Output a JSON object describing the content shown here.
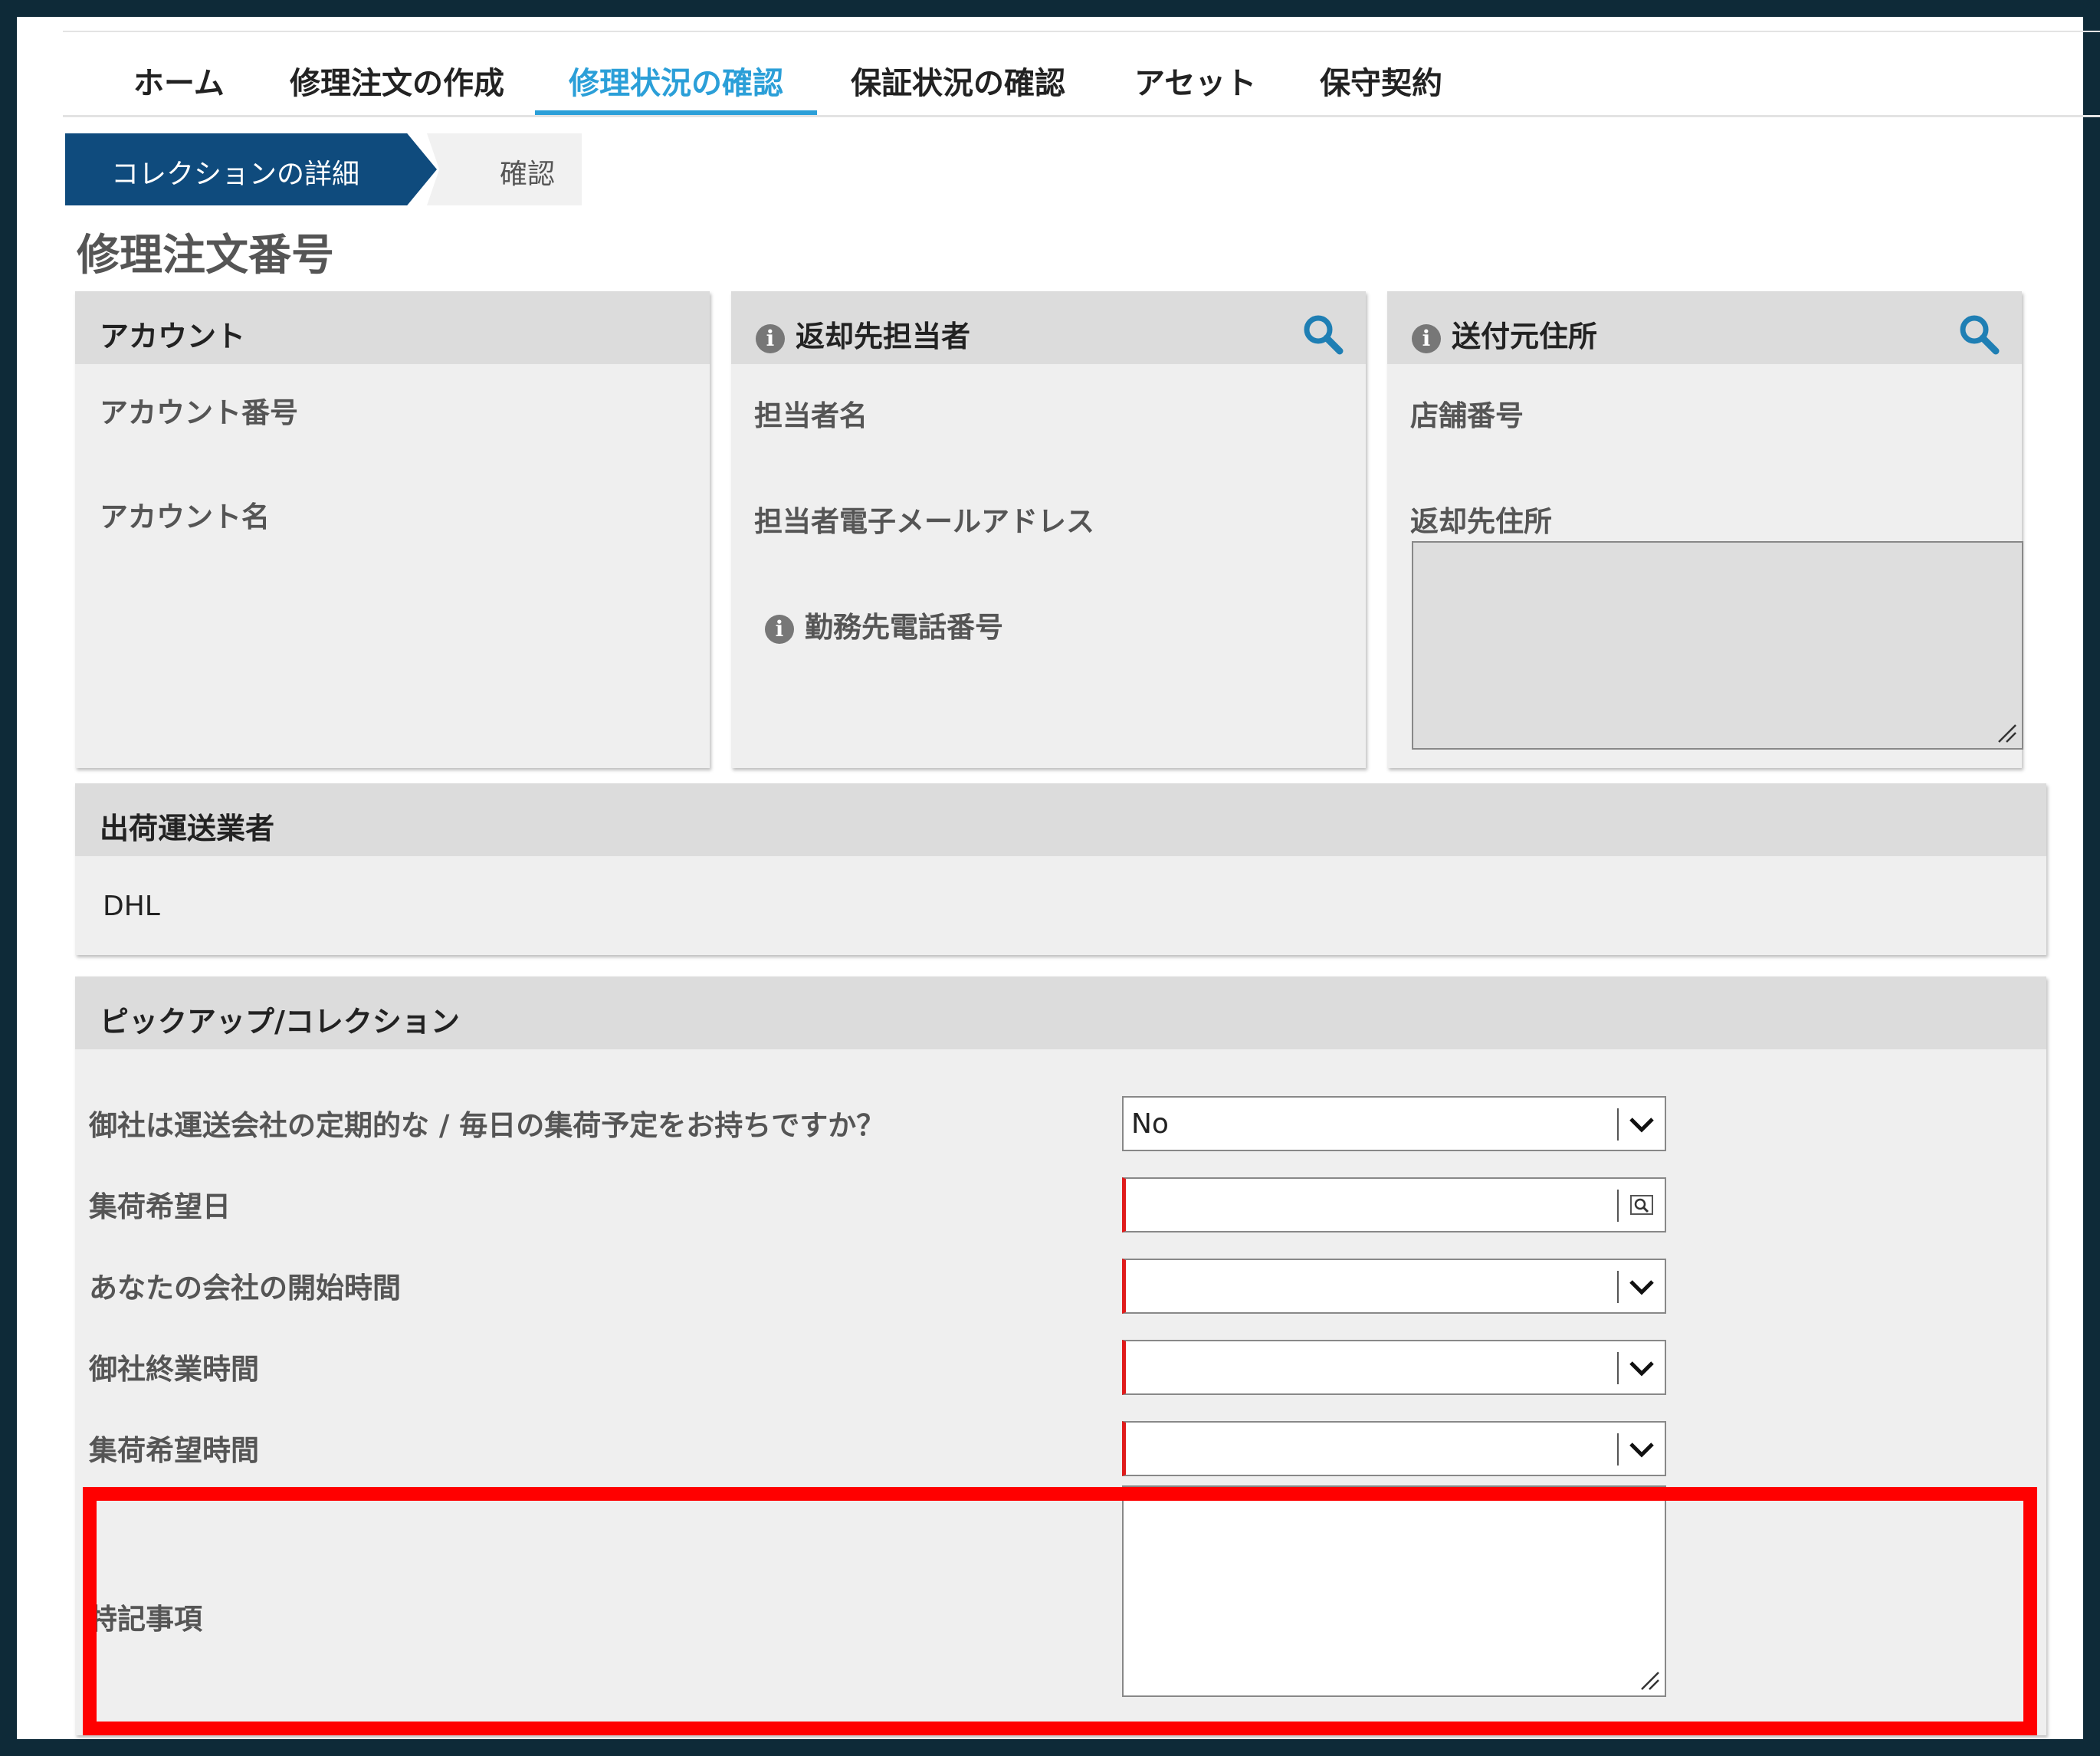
{
  "nav": {
    "items": [
      "ホーム",
      "修理注文の作成",
      "修理状況の確認",
      "保証状況の確認",
      "アセット",
      "保守契約"
    ],
    "active_index": 2
  },
  "breadcrumb": {
    "active": "コレクションの詳細",
    "next": "確認"
  },
  "page_title": "修理注文番号",
  "account_panel": {
    "title": "アカウント",
    "account_number_label": "アカウント番号",
    "account_name_label": "アカウント名"
  },
  "contact_panel": {
    "title": "返却先担当者",
    "name_label": "担当者名",
    "email_label": "担当者電子メールアドレス",
    "phone_label": "勤務先電話番号"
  },
  "address_panel": {
    "title": "送付元住所",
    "store_number_label": "店舗番号",
    "return_address_label": "返却先住所"
  },
  "carrier_panel": {
    "title": "出荷運送業者",
    "value": "DHL"
  },
  "pickup_panel": {
    "title": "ピックアップ/コレクション",
    "fields": [
      {
        "label": "御社は運送会社の定期的な / 毎日の集荷予定をお持ちですか？",
        "value": "No"
      },
      {
        "label": "集荷希望日",
        "value": ""
      },
      {
        "label": "あなたの会社の開始時間",
        "value": ""
      },
      {
        "label": "御社終業時間",
        "value": ""
      },
      {
        "label": "集荷希望時間",
        "value": ""
      }
    ],
    "notes_label": "特記事項"
  },
  "colors": {
    "nav_active": "#2b9fd8",
    "breadcrumb_active": "#0f4b7d",
    "search_icon": "#1f7fb4",
    "required": "#e01b1b",
    "highlight": "#ff0000",
    "frame": "#0e2a38"
  }
}
